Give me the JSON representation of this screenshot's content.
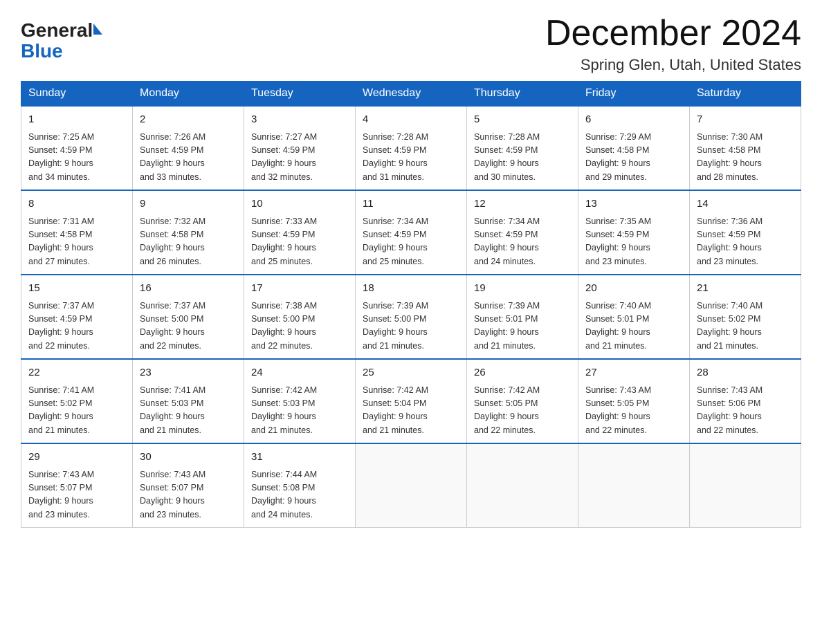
{
  "header": {
    "month_title": "December 2024",
    "location": "Spring Glen, Utah, United States",
    "logo_line1": "General",
    "logo_line2": "Blue"
  },
  "days_of_week": [
    "Sunday",
    "Monday",
    "Tuesday",
    "Wednesday",
    "Thursday",
    "Friday",
    "Saturday"
  ],
  "weeks": [
    [
      {
        "day": "1",
        "sunrise": "7:25 AM",
        "sunset": "4:59 PM",
        "daylight": "9 hours and 34 minutes."
      },
      {
        "day": "2",
        "sunrise": "7:26 AM",
        "sunset": "4:59 PM",
        "daylight": "9 hours and 33 minutes."
      },
      {
        "day": "3",
        "sunrise": "7:27 AM",
        "sunset": "4:59 PM",
        "daylight": "9 hours and 32 minutes."
      },
      {
        "day": "4",
        "sunrise": "7:28 AM",
        "sunset": "4:59 PM",
        "daylight": "9 hours and 31 minutes."
      },
      {
        "day": "5",
        "sunrise": "7:28 AM",
        "sunset": "4:59 PM",
        "daylight": "9 hours and 30 minutes."
      },
      {
        "day": "6",
        "sunrise": "7:29 AM",
        "sunset": "4:58 PM",
        "daylight": "9 hours and 29 minutes."
      },
      {
        "day": "7",
        "sunrise": "7:30 AM",
        "sunset": "4:58 PM",
        "daylight": "9 hours and 28 minutes."
      }
    ],
    [
      {
        "day": "8",
        "sunrise": "7:31 AM",
        "sunset": "4:58 PM",
        "daylight": "9 hours and 27 minutes."
      },
      {
        "day": "9",
        "sunrise": "7:32 AM",
        "sunset": "4:58 PM",
        "daylight": "9 hours and 26 minutes."
      },
      {
        "day": "10",
        "sunrise": "7:33 AM",
        "sunset": "4:59 PM",
        "daylight": "9 hours and 25 minutes."
      },
      {
        "day": "11",
        "sunrise": "7:34 AM",
        "sunset": "4:59 PM",
        "daylight": "9 hours and 25 minutes."
      },
      {
        "day": "12",
        "sunrise": "7:34 AM",
        "sunset": "4:59 PM",
        "daylight": "9 hours and 24 minutes."
      },
      {
        "day": "13",
        "sunrise": "7:35 AM",
        "sunset": "4:59 PM",
        "daylight": "9 hours and 23 minutes."
      },
      {
        "day": "14",
        "sunrise": "7:36 AM",
        "sunset": "4:59 PM",
        "daylight": "9 hours and 23 minutes."
      }
    ],
    [
      {
        "day": "15",
        "sunrise": "7:37 AM",
        "sunset": "4:59 PM",
        "daylight": "9 hours and 22 minutes."
      },
      {
        "day": "16",
        "sunrise": "7:37 AM",
        "sunset": "5:00 PM",
        "daylight": "9 hours and 22 minutes."
      },
      {
        "day": "17",
        "sunrise": "7:38 AM",
        "sunset": "5:00 PM",
        "daylight": "9 hours and 22 minutes."
      },
      {
        "day": "18",
        "sunrise": "7:39 AM",
        "sunset": "5:00 PM",
        "daylight": "9 hours and 21 minutes."
      },
      {
        "day": "19",
        "sunrise": "7:39 AM",
        "sunset": "5:01 PM",
        "daylight": "9 hours and 21 minutes."
      },
      {
        "day": "20",
        "sunrise": "7:40 AM",
        "sunset": "5:01 PM",
        "daylight": "9 hours and 21 minutes."
      },
      {
        "day": "21",
        "sunrise": "7:40 AM",
        "sunset": "5:02 PM",
        "daylight": "9 hours and 21 minutes."
      }
    ],
    [
      {
        "day": "22",
        "sunrise": "7:41 AM",
        "sunset": "5:02 PM",
        "daylight": "9 hours and 21 minutes."
      },
      {
        "day": "23",
        "sunrise": "7:41 AM",
        "sunset": "5:03 PM",
        "daylight": "9 hours and 21 minutes."
      },
      {
        "day": "24",
        "sunrise": "7:42 AM",
        "sunset": "5:03 PM",
        "daylight": "9 hours and 21 minutes."
      },
      {
        "day": "25",
        "sunrise": "7:42 AM",
        "sunset": "5:04 PM",
        "daylight": "9 hours and 21 minutes."
      },
      {
        "day": "26",
        "sunrise": "7:42 AM",
        "sunset": "5:05 PM",
        "daylight": "9 hours and 22 minutes."
      },
      {
        "day": "27",
        "sunrise": "7:43 AM",
        "sunset": "5:05 PM",
        "daylight": "9 hours and 22 minutes."
      },
      {
        "day": "28",
        "sunrise": "7:43 AM",
        "sunset": "5:06 PM",
        "daylight": "9 hours and 22 minutes."
      }
    ],
    [
      {
        "day": "29",
        "sunrise": "7:43 AM",
        "sunset": "5:07 PM",
        "daylight": "9 hours and 23 minutes."
      },
      {
        "day": "30",
        "sunrise": "7:43 AM",
        "sunset": "5:07 PM",
        "daylight": "9 hours and 23 minutes."
      },
      {
        "day": "31",
        "sunrise": "7:44 AM",
        "sunset": "5:08 PM",
        "daylight": "9 hours and 24 minutes."
      },
      null,
      null,
      null,
      null
    ]
  ],
  "labels": {
    "sunrise": "Sunrise:",
    "sunset": "Sunset:",
    "daylight": "Daylight:"
  }
}
